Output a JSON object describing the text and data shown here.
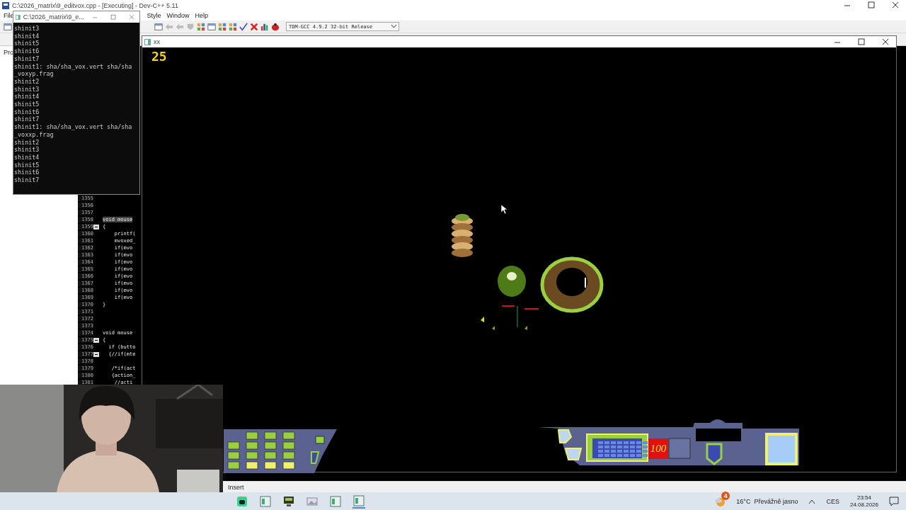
{
  "ide": {
    "title": "C:\\2026_matrix\\9_editvox.cpp - [Executing] - Dev-C++ 5.11",
    "menu": [
      "File",
      "Style",
      "Window",
      "Help"
    ],
    "compiler": "TDM-GCC 4.9.2 32-bit Release",
    "panel_tab": "Pro",
    "status": "Insert"
  },
  "editor": {
    "lines": [
      {
        "number": "1355",
        "fold": false
      },
      {
        "number": "1356",
        "fold": false
      },
      {
        "number": "1357",
        "fold": false
      },
      {
        "number": "1358",
        "code": "void mouse",
        "fold": false,
        "highlighted": true
      },
      {
        "number": "1359",
        "code": "{",
        "fold": true,
        "highlighted": false
      },
      {
        "number": "1360",
        "code": "    printf(",
        "fold": false,
        "highlighted": false
      },
      {
        "number": "1361",
        "code": "    mvoxed_",
        "fold": false,
        "highlighted": false
      },
      {
        "number": "1362",
        "code": "    if(mvo",
        "fold": false,
        "highlighted": false
      },
      {
        "number": "1363",
        "code": "    if(mvo",
        "fold": false,
        "highlighted": false
      },
      {
        "number": "1364",
        "code": "    if(mvo",
        "fold": false,
        "highlighted": false
      },
      {
        "number": "1365",
        "code": "    if(mvo",
        "fold": false,
        "highlighted": false
      },
      {
        "number": "1366",
        "code": "    if(mvo",
        "fold": false,
        "highlighted": false
      },
      {
        "number": "1367",
        "code": "    if(mvo",
        "fold": false,
        "highlighted": false
      },
      {
        "number": "1368",
        "code": "    if(mvo",
        "fold": false,
        "highlighted": false
      },
      {
        "number": "1369",
        "code": "    if(mvo",
        "fold": false,
        "highlighted": false
      },
      {
        "number": "1370",
        "code": "}",
        "fold": false,
        "highlighted": false
      },
      {
        "number": "1371",
        "fold": false
      },
      {
        "number": "1372",
        "fold": false
      },
      {
        "number": "1373",
        "fold": false
      },
      {
        "number": "1374",
        "code": "void mouse",
        "fold": false,
        "highlighted": false
      },
      {
        "number": "1375",
        "code": "{",
        "fold": true,
        "highlighted": false
      },
      {
        "number": "1376",
        "code": "  if (butto",
        "fold": false,
        "highlighted": false
      },
      {
        "number": "1377",
        "code": "  {//if(mte",
        "fold": true,
        "highlighted": false
      },
      {
        "number": "1378",
        "fold": false
      },
      {
        "number": "1379",
        "code": "   /*if(act",
        "fold": false,
        "highlighted": false
      },
      {
        "number": "1380",
        "code": "   {action_",
        "fold": false,
        "highlighted": false
      },
      {
        "number": "1381",
        "code": "    //acti",
        "fold": false,
        "highlighted": false
      }
    ]
  },
  "console": {
    "title": "C:\\2026_matrix\\9_e...",
    "lines": [
      "shinit3",
      "shinit4",
      "shinit5",
      "shinit6",
      "shinit7",
      "shinit1: sha/sha_vox.vert sha/sha",
      "_voxyp.frag",
      "shinit2",
      "shinit3",
      "shinit4",
      "shinit5",
      "shinit6",
      "shinit7",
      "shinit1: sha/sha_vox.vert sha/sha",
      "_voxxp.frag",
      "shinit2",
      "shinit3",
      "shinit4",
      "shinit5",
      "shinit6",
      "shinit7"
    ]
  },
  "game": {
    "title": "xx",
    "fps": "25",
    "counter": "100"
  },
  "taskbar": {
    "weather_badge": "4",
    "weather": "16°C  Převážně jasno",
    "language": "CES",
    "time": "23:54",
    "date": "24.08.2026"
  }
}
